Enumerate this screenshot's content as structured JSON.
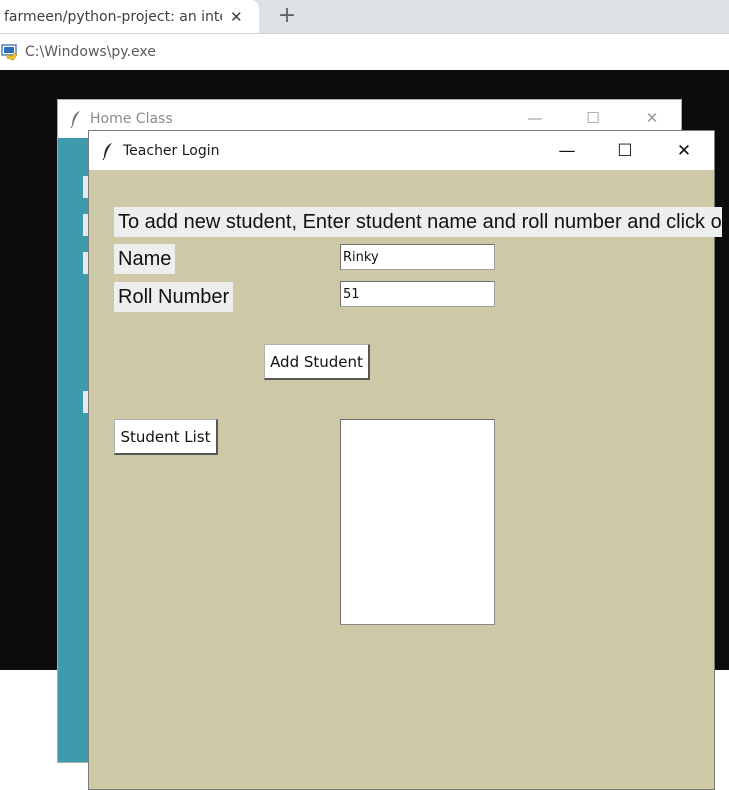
{
  "browser": {
    "tab_title": "farmeen/python-project: an interactive",
    "tab_close": "✕",
    "new_tab": "+"
  },
  "console": {
    "title": "C:\\Windows\\py.exe"
  },
  "home_window": {
    "title": "Home Class",
    "minimize": "—",
    "maximize": "☐",
    "close": "✕"
  },
  "teacher_window": {
    "title": "Teacher Login",
    "minimize": "—",
    "maximize": "☐",
    "close": "✕",
    "instruction": "To add new student, Enter student name and roll number and click on",
    "name_label": "Name",
    "name_value": "Rinky",
    "roll_label": "Roll Number",
    "roll_value": "51",
    "add_button": "Add Student",
    "list_button": "Student List",
    "student_list": []
  },
  "colors": {
    "teacher_bg": "#cdc8a6",
    "home_bg": "#3e9bab",
    "console_bg": "#0c0c0c"
  }
}
